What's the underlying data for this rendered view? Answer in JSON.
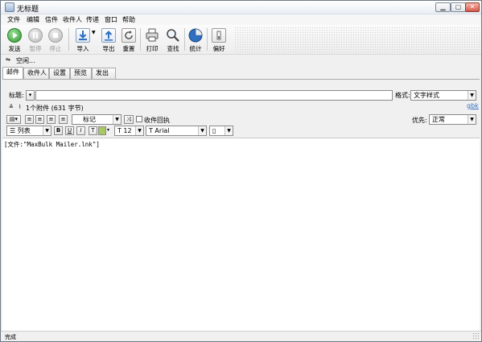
{
  "window": {
    "title": "无标题"
  },
  "window_controls": {
    "minimize": "▁",
    "maximize": "▢",
    "close": "✕"
  },
  "menu": [
    "文件",
    "编辑",
    "信件",
    "收件人",
    "传递",
    "窗口",
    "帮助"
  ],
  "toolbar": {
    "buttons": [
      {
        "label": "发送",
        "icon": "send-icon",
        "enabled": true
      },
      {
        "label": "暂停",
        "icon": "pause-icon",
        "enabled": false
      },
      {
        "label": "停止",
        "icon": "stop-icon",
        "enabled": false
      },
      {
        "label": "导入",
        "icon": "import-icon",
        "enabled": true
      },
      {
        "label": "导出",
        "icon": "export-icon",
        "enabled": true
      },
      {
        "label": "重置",
        "icon": "reset-icon",
        "enabled": true
      },
      {
        "label": "打印",
        "icon": "print-icon",
        "enabled": true
      },
      {
        "label": "查找",
        "icon": "find-icon",
        "enabled": true
      },
      {
        "label": "统计",
        "icon": "stats-icon",
        "enabled": true
      },
      {
        "label": "偏好",
        "icon": "preferences-icon",
        "enabled": true
      }
    ]
  },
  "address_line": {
    "text": "空闲..."
  },
  "tabs": [
    "邮件",
    "收件人",
    "设置",
    "预览",
    "发出"
  ],
  "subject": {
    "label": "标题:",
    "value": ""
  },
  "format": {
    "label": "格式:",
    "value": "文字样式"
  },
  "charset_link": "gbk",
  "attachments": {
    "text": "1个附件 (631 字节)"
  },
  "format_bar": {
    "marker": "标记",
    "receipt": "收件回执",
    "priority_label": "优先:",
    "priority_value": "正常",
    "list": "列表",
    "bold": "B",
    "underline": "U",
    "italic": "I",
    "text_color": "T",
    "size": "T 12",
    "font": "T Arial"
  },
  "editor": {
    "content": "[文件:\"MaxBulk Mailer.lnk\"]"
  },
  "status": {
    "text": "完成"
  },
  "colors": {
    "accent": "#2f6fc0",
    "send": "#3aa83a",
    "chrome": "#f0f0f0"
  }
}
